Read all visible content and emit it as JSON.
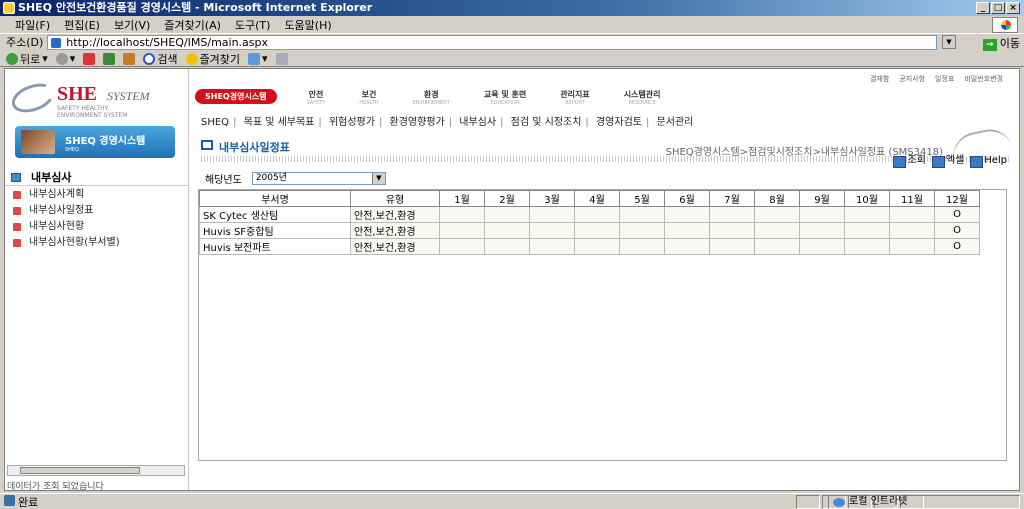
{
  "window": {
    "title": "SHEQ 안전보건환경품질 경영시스템 - Microsoft Internet Explorer",
    "controls": [
      "_",
      "□",
      "×"
    ]
  },
  "menubar": [
    "파일(F)",
    "편집(E)",
    "보기(V)",
    "즐겨찾기(A)",
    "도구(T)",
    "도움말(H)"
  ],
  "address": {
    "label": "주소(D)",
    "url": "http://localhost/SHEQ/IMS/main.aspx",
    "go_label": "이동"
  },
  "toolbar": {
    "back": "뒤로",
    "search": "검색",
    "favorites": "즐겨찾기"
  },
  "sidebar": {
    "logo_she": "SHE",
    "logo_system": "SYSTEM",
    "logo_sub1": "SAFETY HEALTHY",
    "logo_sub2": "ENVIRONMENT SYSTEM",
    "banner_title": "SHEQ 경영시스템",
    "banner_sub": "SHEQ",
    "section_title": "내부심사",
    "items": [
      {
        "label": "내부심사계획"
      },
      {
        "label": "내부심사일정표"
      },
      {
        "label": "내부심사현황"
      },
      {
        "label": "내부심사현황(부서별)"
      }
    ],
    "status_text": "데이터가 조회 되었습니다"
  },
  "topnav": {
    "util_links": [
      "결재함",
      "공지사항",
      "일정표",
      "비밀번호변경"
    ],
    "active_menu": "SHEQ경영시스템",
    "menus": [
      {
        "label": "안전",
        "sub": "SAFETY"
      },
      {
        "label": "보건",
        "sub": "HEALTH"
      },
      {
        "label": "환경",
        "sub": "ENVIRONMENT"
      },
      {
        "label": "교육 및 훈련",
        "sub": "EDUCATION"
      },
      {
        "label": "관리지표",
        "sub": "REPORT"
      },
      {
        "label": "시스템관리",
        "sub": "RESOURCE"
      }
    ],
    "submenu": [
      "SHEQ",
      "목표 및 세부목표",
      "위험성평가",
      "환경영향평가",
      "내부심사",
      "점검 및 시정조치",
      "경영자검토",
      "문서관리"
    ]
  },
  "content": {
    "title": "내부심사일정표",
    "breadcrumb": "SHEQ경영시스템>점검및시정조치>내부심사일정표 (SMS3418)",
    "buttons": {
      "search": "조회",
      "excel": "엑셀",
      "help": "Help"
    },
    "year_label": "해당년도",
    "year_value": "2005년",
    "table": {
      "headers": [
        "부서명",
        "유형",
        "1월",
        "2월",
        "3월",
        "4월",
        "5월",
        "6월",
        "7월",
        "8월",
        "9월",
        "10월",
        "11월",
        "12월"
      ],
      "rows": [
        {
          "dept": "SK Cytec 생산팀",
          "type": "안전,보건,환경",
          "m12": "O"
        },
        {
          "dept": "Huvis SF중합팀",
          "type": "안전,보건,환경",
          "m12": "O"
        },
        {
          "dept": "Huvis 보전파트",
          "type": "안전,보건,환경",
          "m12": "O"
        }
      ]
    }
  },
  "status": {
    "done": "완료",
    "zone": "로컬 인트라넷"
  }
}
